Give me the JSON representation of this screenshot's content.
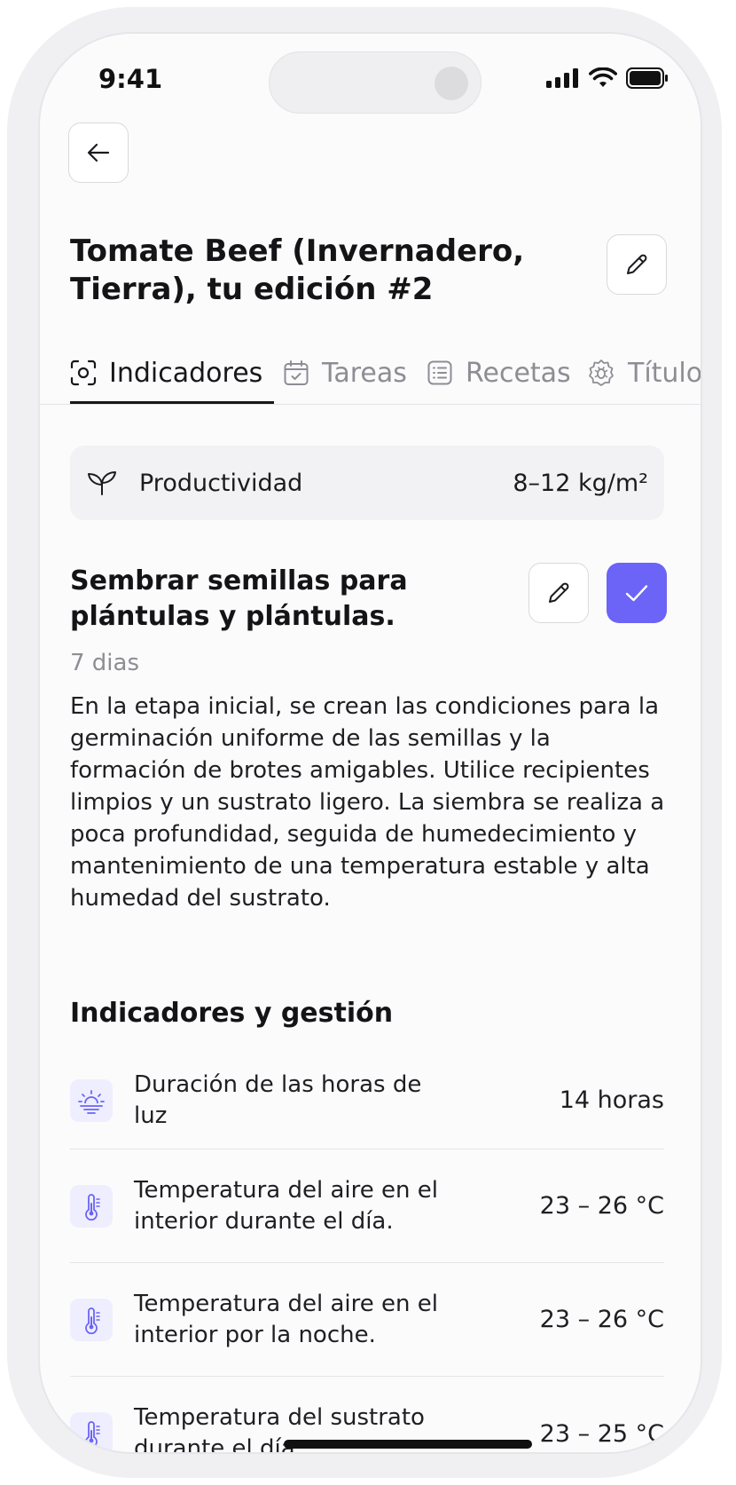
{
  "status_bar": {
    "time": "9:41"
  },
  "header": {
    "title": "Tomate Beef (Invernadero, Tierra), tu edición #2"
  },
  "tabs": [
    {
      "label": "Indicadores",
      "icon": "scan-icon",
      "active": true
    },
    {
      "label": "Tareas",
      "icon": "calendar-check-icon",
      "active": false
    },
    {
      "label": "Recetas",
      "icon": "list-icon",
      "active": false
    },
    {
      "label": "Títulos",
      "icon": "bug-gear-icon",
      "active": false
    }
  ],
  "productivity": {
    "label": "Productividad",
    "value": "8–12 kg/m²",
    "icon": "sprout-icon"
  },
  "stage": {
    "title": "Sembrar semillas para plántulas y plántulas.",
    "duration": "7 dias",
    "description": "En la etapa inicial, se crean las condiciones para la germinación uniforme de las semillas y la formación de brotes amigables. Utilice recipientes limpios y un sustrato ligero. La siembra se realiza a poca profundidad, seguida de humedecimiento y mantenimiento de una temperatura estable y alta humedad del sustrato."
  },
  "indicators": {
    "title": "Indicadores y gestión",
    "items": [
      {
        "icon": "sunrise-icon",
        "label": "Duración de las horas de luz",
        "value": "14 horas"
      },
      {
        "icon": "thermometer-icon",
        "label": "Temperatura del aire en el interior durante el día.",
        "value": "23 – 26 °C"
      },
      {
        "icon": "thermometer-icon",
        "label": "Temperatura del aire en el interior por la noche.",
        "value": "23 – 26 °C"
      },
      {
        "icon": "thermometer-icon",
        "label": "Temperatura del sustrato durante el día.",
        "value": "23 – 25 °C"
      }
    ]
  },
  "colors": {
    "accent": "#6b64f6",
    "icon_bg": "#eeeefe",
    "card_bg": "#f2f2f4"
  }
}
